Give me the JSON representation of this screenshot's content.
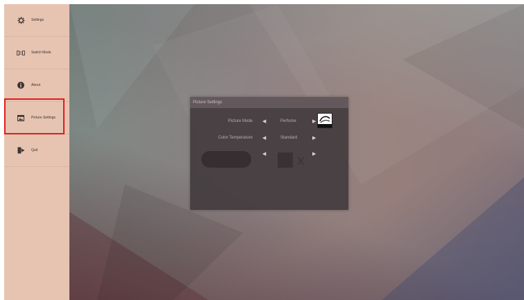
{
  "sidebar": {
    "items": [
      {
        "label": "Settings",
        "icon": "gear-icon"
      },
      {
        "label": "Switch Mode",
        "icon": "switch-mode-icon"
      },
      {
        "label": "About",
        "icon": "info-icon"
      },
      {
        "label": "Picture Settings",
        "icon": "picture-icon"
      },
      {
        "label": "Quit",
        "icon": "exit-icon"
      }
    ],
    "highlighted_item": "Picture Settings",
    "highlight_color": "#e01c1c"
  },
  "dialog": {
    "title": "Picture Settings",
    "rows": [
      {
        "label": "Picture Mode",
        "value": "Perfume"
      },
      {
        "label": "Color Temperature",
        "value": "Standard"
      }
    ],
    "faded_row": {
      "label": "",
      "value": ""
    },
    "energy_badge_icon": "energy-star-icon"
  },
  "colors": {
    "sidebar_bg": "#e6c4b1",
    "dialog_bg": "#443c3e"
  }
}
